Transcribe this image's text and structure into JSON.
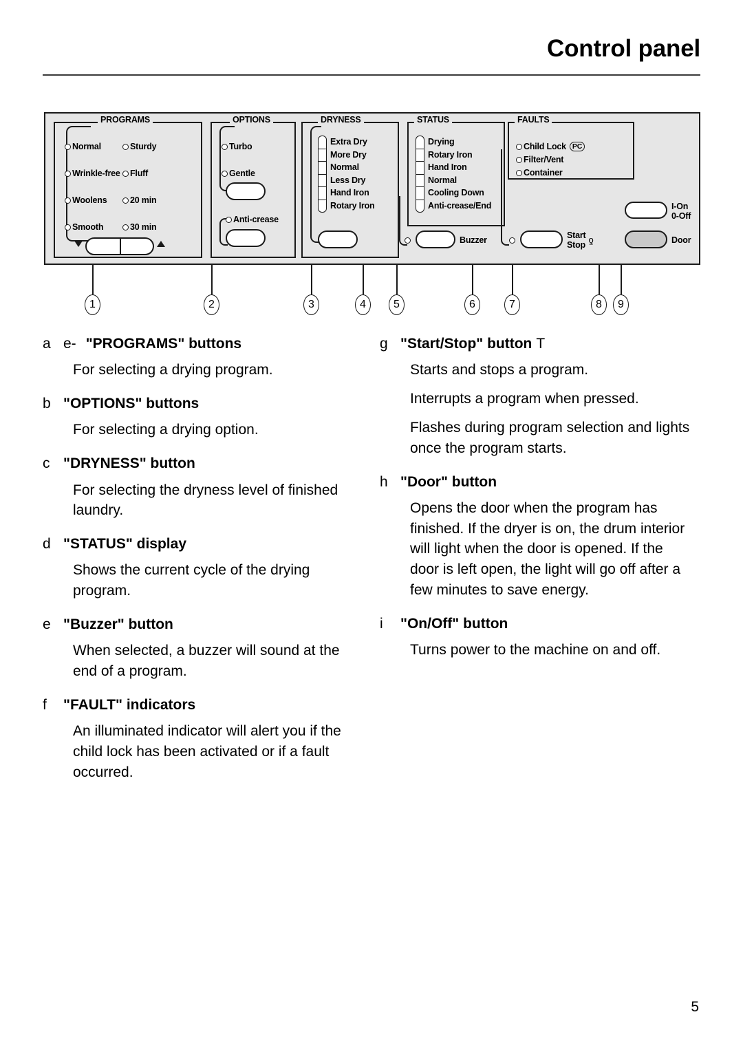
{
  "header": {
    "title": "Control panel"
  },
  "page_number": "5",
  "panel": {
    "programs": {
      "title": "PROGRAMS",
      "left_options": [
        "Normal",
        "Wrinkle-free",
        "Woolens",
        "Smooth"
      ],
      "right_options": [
        "Sturdy",
        "Fluff",
        "20 min",
        "30 min"
      ],
      "rocker_down_icon": "triangle-down-icon",
      "rocker_up_icon": "triangle-up-icon"
    },
    "options": {
      "title": "OPTIONS",
      "items": [
        "Turbo",
        "Gentle"
      ],
      "anti_crease": "Anti-crease"
    },
    "dryness": {
      "title": "DRYNESS",
      "levels": [
        "Extra Dry",
        "More Dry",
        "Normal",
        "Less Dry",
        "Hand Iron",
        "Rotary Iron"
      ]
    },
    "status": {
      "title": "STATUS",
      "levels": [
        "Drying",
        "Rotary Iron",
        "Hand Iron",
        "Normal",
        "Cooling Down",
        "Anti-crease/End"
      ]
    },
    "faults": {
      "title": "FAULTS",
      "items": [
        "Child Lock",
        "Filter/Vent",
        "Container"
      ],
      "child_lock_badge": "PC"
    },
    "buzzer": {
      "label": "Buzzer"
    },
    "start_stop": {
      "line1": "Start",
      "line2": "Stop",
      "glyph": "ƍ"
    },
    "on_off": {
      "line1": "I-On",
      "line2": "0-Off"
    },
    "door": {
      "label": "Door"
    },
    "callouts": [
      "1",
      "2",
      "3",
      "4",
      "5",
      "6",
      "7",
      "8",
      "9"
    ]
  },
  "left_column": [
    {
      "letter": "a",
      "sub_letter": "e-",
      "title": "\"PROGRAMS\" buttons",
      "trailing": "",
      "paragraphs": [
        "For selecting a drying program."
      ]
    },
    {
      "letter": "b",
      "sub_letter": "",
      "title": "\"OPTIONS\" buttons",
      "trailing": "",
      "paragraphs": [
        "For selecting a drying option."
      ]
    },
    {
      "letter": "c",
      "sub_letter": "",
      "title": "\"DRYNESS\" button",
      "trailing": "",
      "paragraphs": [
        "For selecting the dryness level of finished laundry."
      ]
    },
    {
      "letter": "d",
      "sub_letter": "",
      "title": "\"STATUS\" display",
      "trailing": "",
      "paragraphs": [
        "Shows the current cycle of the drying program."
      ]
    },
    {
      "letter": "e",
      "sub_letter": "",
      "title": "\"Buzzer\" button",
      "trailing": "",
      "paragraphs": [
        "When selected, a buzzer will sound at the end of a program."
      ]
    },
    {
      "letter": "f",
      "sub_letter": "",
      "title": "\"FAULT\" indicators",
      "trailing": "",
      "paragraphs": [
        "An illuminated indicator will alert you if the child lock has been activated or if a fault occurred."
      ]
    }
  ],
  "right_column": [
    {
      "letter": "g",
      "sub_letter": "",
      "title": "\"Start/Stop\" button",
      "trailing": "T",
      "paragraphs": [
        "Starts and stops a program.",
        "Interrupts a program when pressed.",
        "Flashes during program selection and lights once the program starts."
      ]
    },
    {
      "letter": "h",
      "sub_letter": "",
      "title": "\"Door\" button",
      "trailing": "",
      "paragraphs": [
        "Opens the door when the program has finished. If the dryer is on, the drum interior will light when the door is opened. If the door is left open, the light will go off after a few minutes to save energy."
      ]
    },
    {
      "letter": "i",
      "sub_letter": "",
      "title": "\"On/Off\" button",
      "trailing": "",
      "paragraphs": [
        "Turns power to the machine on and off."
      ]
    }
  ]
}
